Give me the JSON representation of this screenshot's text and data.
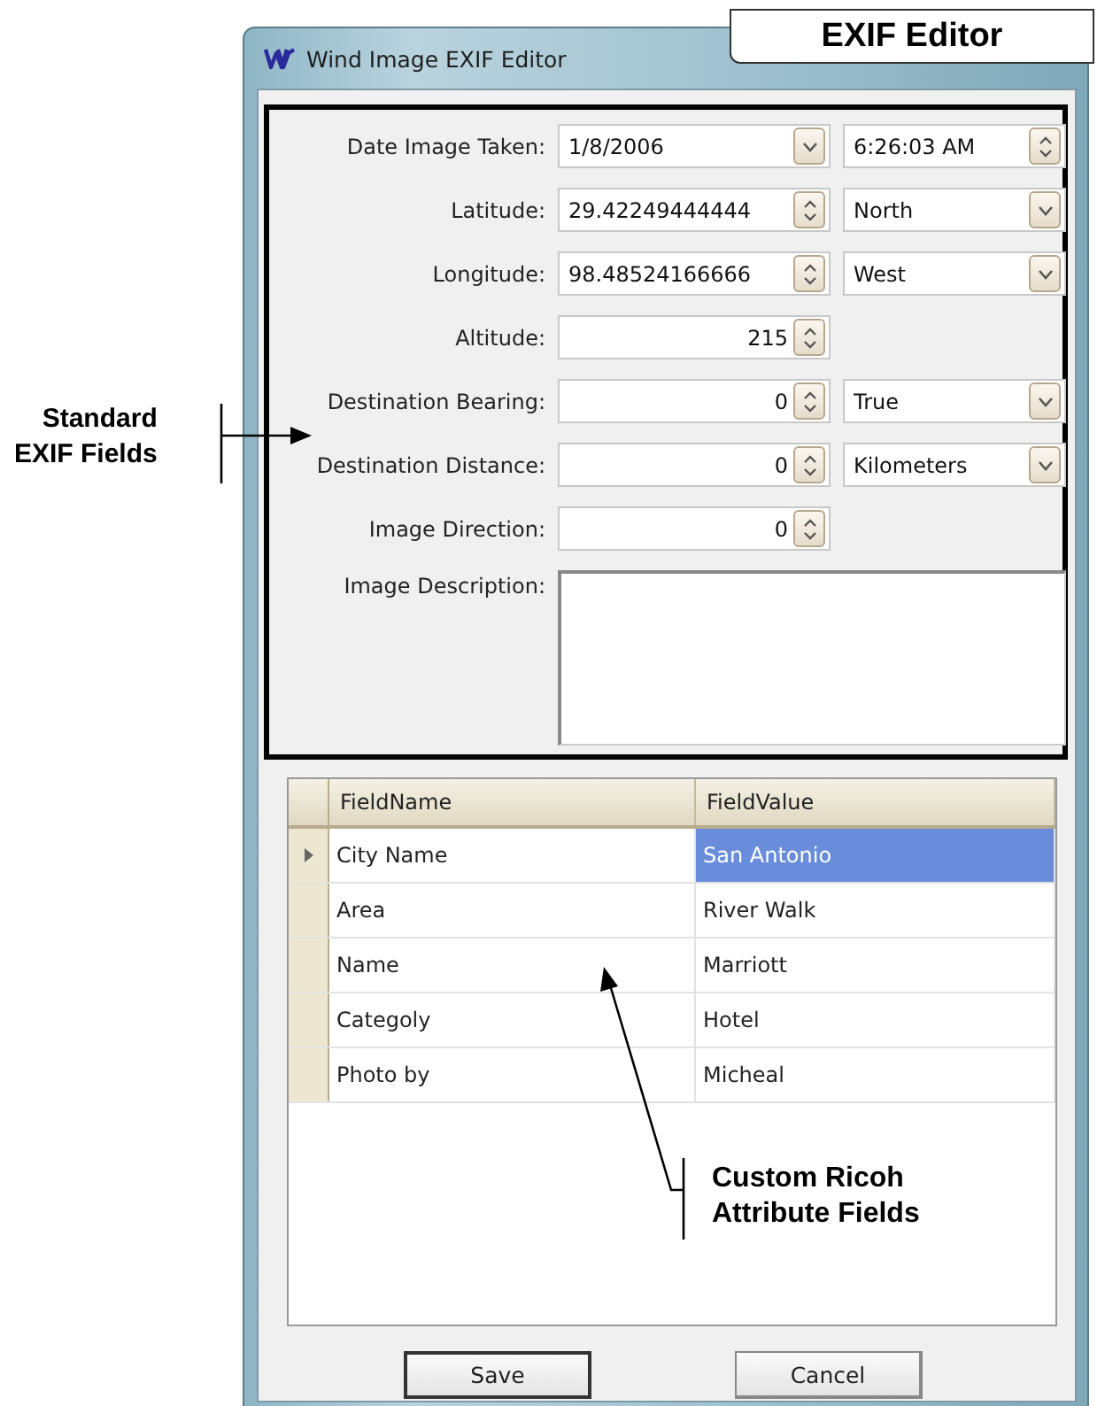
{
  "callout": {
    "text": "EXIF Editor"
  },
  "window": {
    "title": "Wind Image EXIF Editor"
  },
  "fields": [
    {
      "label": "Date Image Taken:",
      "kind": "date",
      "value": "1/8/2006",
      "time": "6:26:03 AM"
    },
    {
      "label": "Latitude:",
      "kind": "coordinate",
      "value": "29.42249444444",
      "option": "North"
    },
    {
      "label": "Longitude:",
      "kind": "coordinate",
      "value": "98.48524166666",
      "option": "West"
    },
    {
      "label": "Altitude:",
      "kind": "number",
      "value": "215"
    },
    {
      "label": "Destination Bearing:",
      "kind": "number",
      "value": "0",
      "option": "True"
    },
    {
      "label": "Destination Distance:",
      "kind": "number",
      "value": "0",
      "option": "Kilometers"
    },
    {
      "label": "Image Direction:",
      "kind": "number",
      "value": "0"
    },
    {
      "label": "Image Description:",
      "kind": "text_area"
    }
  ],
  "grid": {
    "columns": [
      "FieldName",
      "FieldValue"
    ],
    "rows": [
      {
        "field_name": "City Name",
        "field_value": "San Antonio",
        "current": true,
        "value_selected": true
      },
      {
        "field_name": "Area",
        "field_value": "River Walk",
        "current": false,
        "value_selected": false
      },
      {
        "field_name": "Name",
        "field_value": "Marriott",
        "current": false,
        "value_selected": false
      },
      {
        "field_name": "Categoly",
        "field_value": "Hotel",
        "current": false,
        "value_selected": false
      },
      {
        "field_name": "Photo by",
        "field_value": "Micheal",
        "current": false,
        "value_selected": false
      }
    ]
  },
  "buttons": [
    {
      "label": "Save",
      "default": true
    },
    {
      "label": "Cancel",
      "default": false
    }
  ],
  "notes": {
    "standard": {
      "lines": [
        "Standard",
        "EXIF Fields"
      ]
    },
    "custom": {
      "lines": [
        "Custom Ricoh",
        "Attribute Fields"
      ]
    }
  }
}
